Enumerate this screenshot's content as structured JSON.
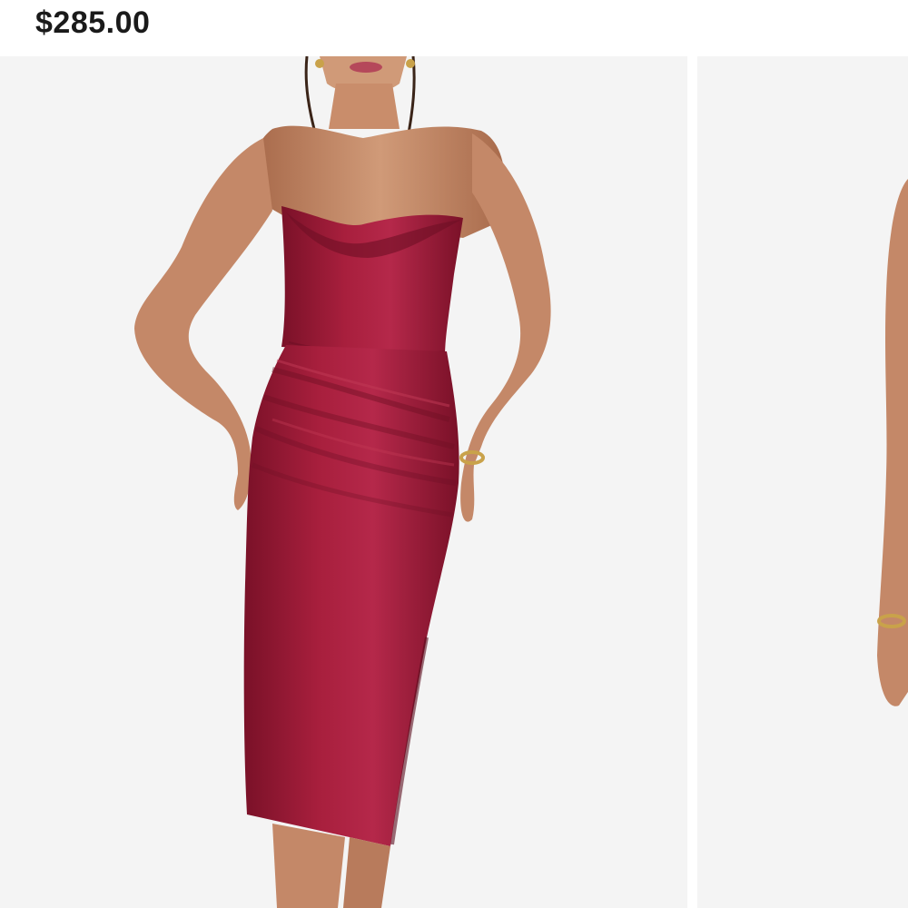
{
  "product": {
    "price": "$285.00"
  },
  "gallery": {
    "images": [
      {
        "alt": "model-wearing-red-strapless-satin-midi-dress-front"
      },
      {
        "alt": "model-wearing-red-strapless-satin-midi-dress-second-view"
      }
    ]
  },
  "colors": {
    "dress": "#9b1b36",
    "dress_shadow": "#6e0f24",
    "dress_highlight": "#c23a55",
    "skin": "#c98d6b",
    "skin_shadow": "#a8694a",
    "background": "#f4f4f4",
    "price_text": "#1a1a1a"
  }
}
